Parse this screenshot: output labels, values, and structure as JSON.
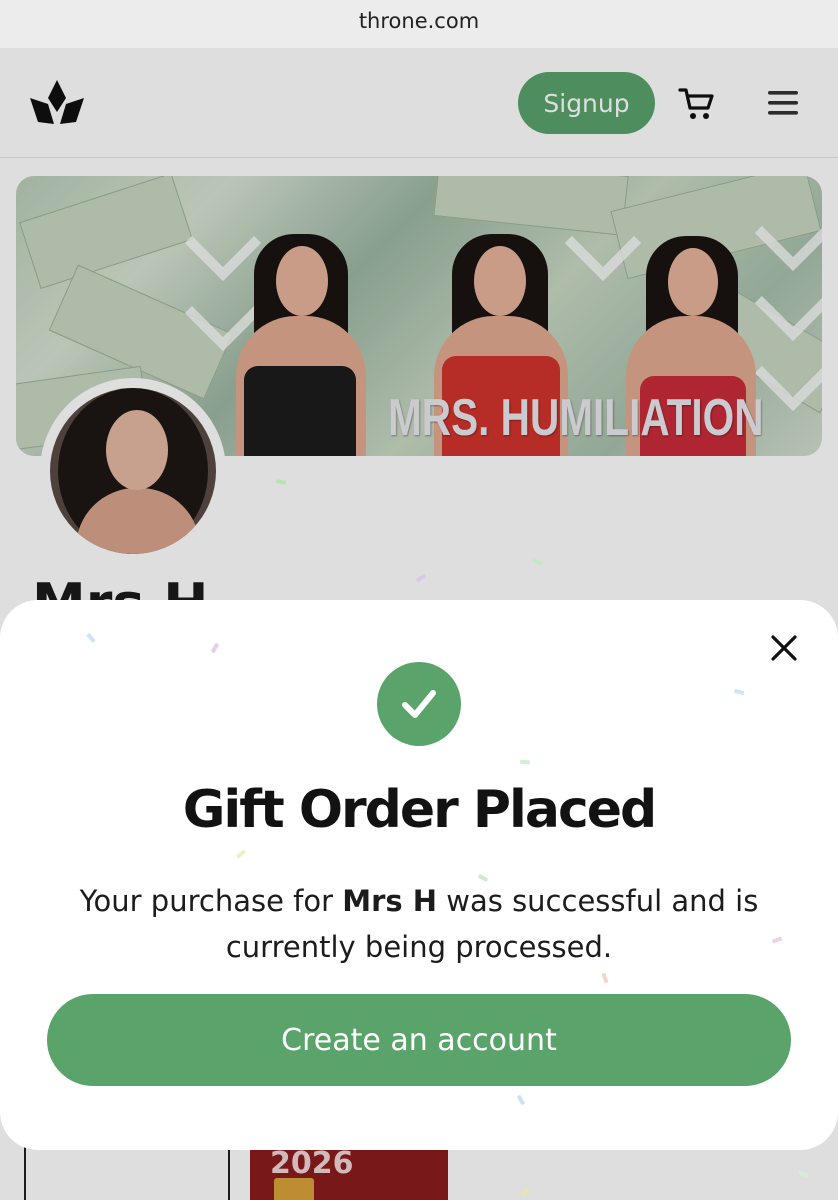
{
  "browser": {
    "url": "throne.com"
  },
  "header": {
    "signup_label": "Signup"
  },
  "banner": {
    "overlay_text": "MRS. HUMILIATION"
  },
  "profile": {
    "name": "Mrs H"
  },
  "peek_cards": {
    "card2_year": "2026"
  },
  "modal": {
    "title": "Gift Order Placed",
    "message_before": "Your purchase for",
    "message_name": "Mrs H",
    "message_after": "was successful and is currently being processed.",
    "cta_label": "Create an account"
  },
  "colors": {
    "accent_green": "#5aa46c",
    "title_black": "#121212",
    "url_bar_bg": "#ececec"
  },
  "icons": [
    "throne-logo-icon",
    "cart-icon",
    "menu-icon",
    "close-icon",
    "checkmark-icon",
    "gift-icon"
  ]
}
